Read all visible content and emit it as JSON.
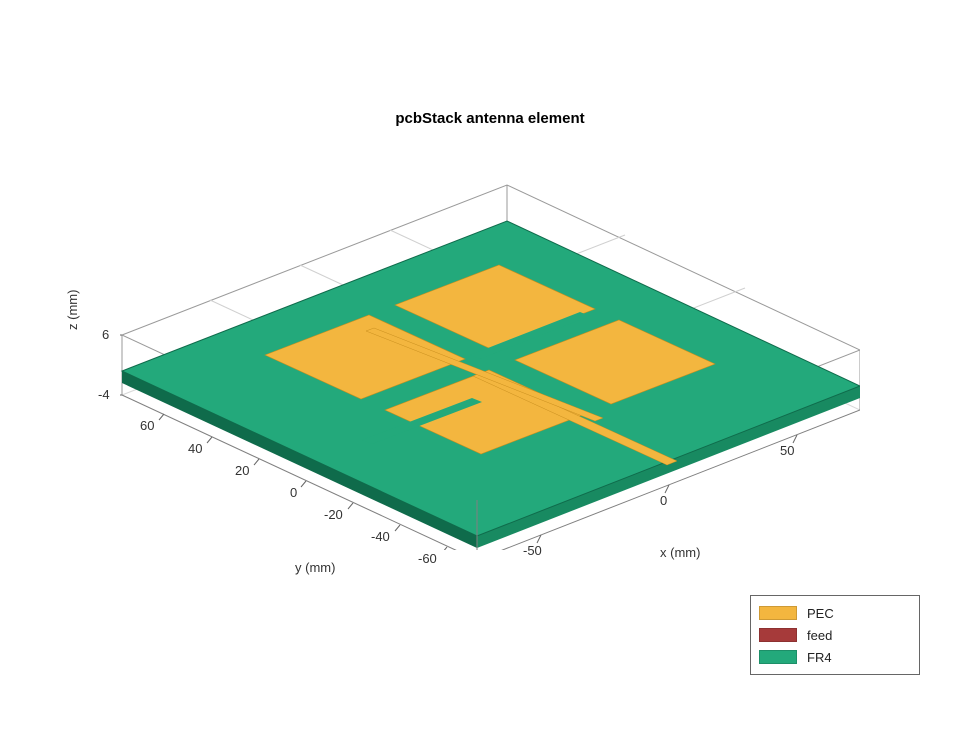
{
  "chart_data": {
    "type": "3d-surface",
    "title": "pcbStack antenna element",
    "xlabel": "x (mm)",
    "ylabel": "y (mm)",
    "zlabel": "z (mm)",
    "x_range": [
      -75,
      75
    ],
    "y_range": [
      -75,
      75
    ],
    "z_range": [
      -4,
      6
    ],
    "x_ticks": [
      -50,
      0,
      50
    ],
    "y_ticks": [
      -60,
      -40,
      -20,
      0,
      20,
      40,
      60
    ],
    "z_ticks": [
      -4,
      6
    ],
    "legend": [
      {
        "label": "PEC",
        "color": "#f3b63f"
      },
      {
        "label": "feed",
        "color": "#a63a3a"
      },
      {
        "label": "FR4",
        "color": "#23a97b"
      }
    ],
    "board": {
      "material": "FR4",
      "x": [
        -75,
        75
      ],
      "y": [
        -75,
        75
      ],
      "thickness_mm_est": 1.5
    },
    "patches": [
      {
        "material": "PEC",
        "cx": -25,
        "cy": 25,
        "w": 40,
        "h": 40
      },
      {
        "material": "PEC",
        "cx": 25,
        "cy": 25,
        "w": 40,
        "h": 40
      },
      {
        "material": "PEC",
        "cx": -25,
        "cy": -25,
        "w": 40,
        "h": 40
      },
      {
        "material": "PEC",
        "cx": 25,
        "cy": -25,
        "w": 40,
        "h": 40
      }
    ],
    "feedline": {
      "material": "PEC",
      "description": "narrow microstrip running along x between patches with short stubs",
      "width_mm_est": 3
    }
  }
}
